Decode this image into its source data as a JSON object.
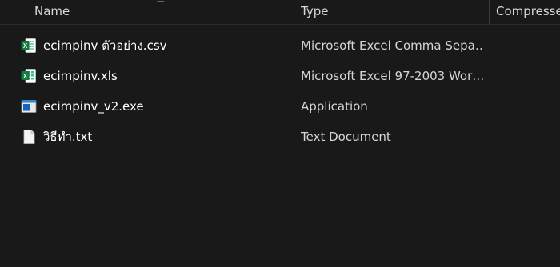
{
  "columns": {
    "name": "Name",
    "type": "Type",
    "compressed": "Compressed size"
  },
  "files": [
    {
      "name": "ecimpinv ตัวอย่าง.csv",
      "type": "Microsoft Excel Comma Sepa…",
      "icon": "excel-csv-icon"
    },
    {
      "name": "ecimpinv.xls",
      "type": "Microsoft Excel 97-2003 Wor…",
      "icon": "excel-xls-icon"
    },
    {
      "name": "ecimpinv_v2.exe",
      "type": "Application",
      "icon": "application-icon"
    },
    {
      "name": "วิธีทำ.txt",
      "type": "Text Document",
      "icon": "text-document-icon"
    }
  ],
  "colors": {
    "background": "#191919",
    "excel_green": "#107c41",
    "app_blue": "#1e88e5"
  }
}
